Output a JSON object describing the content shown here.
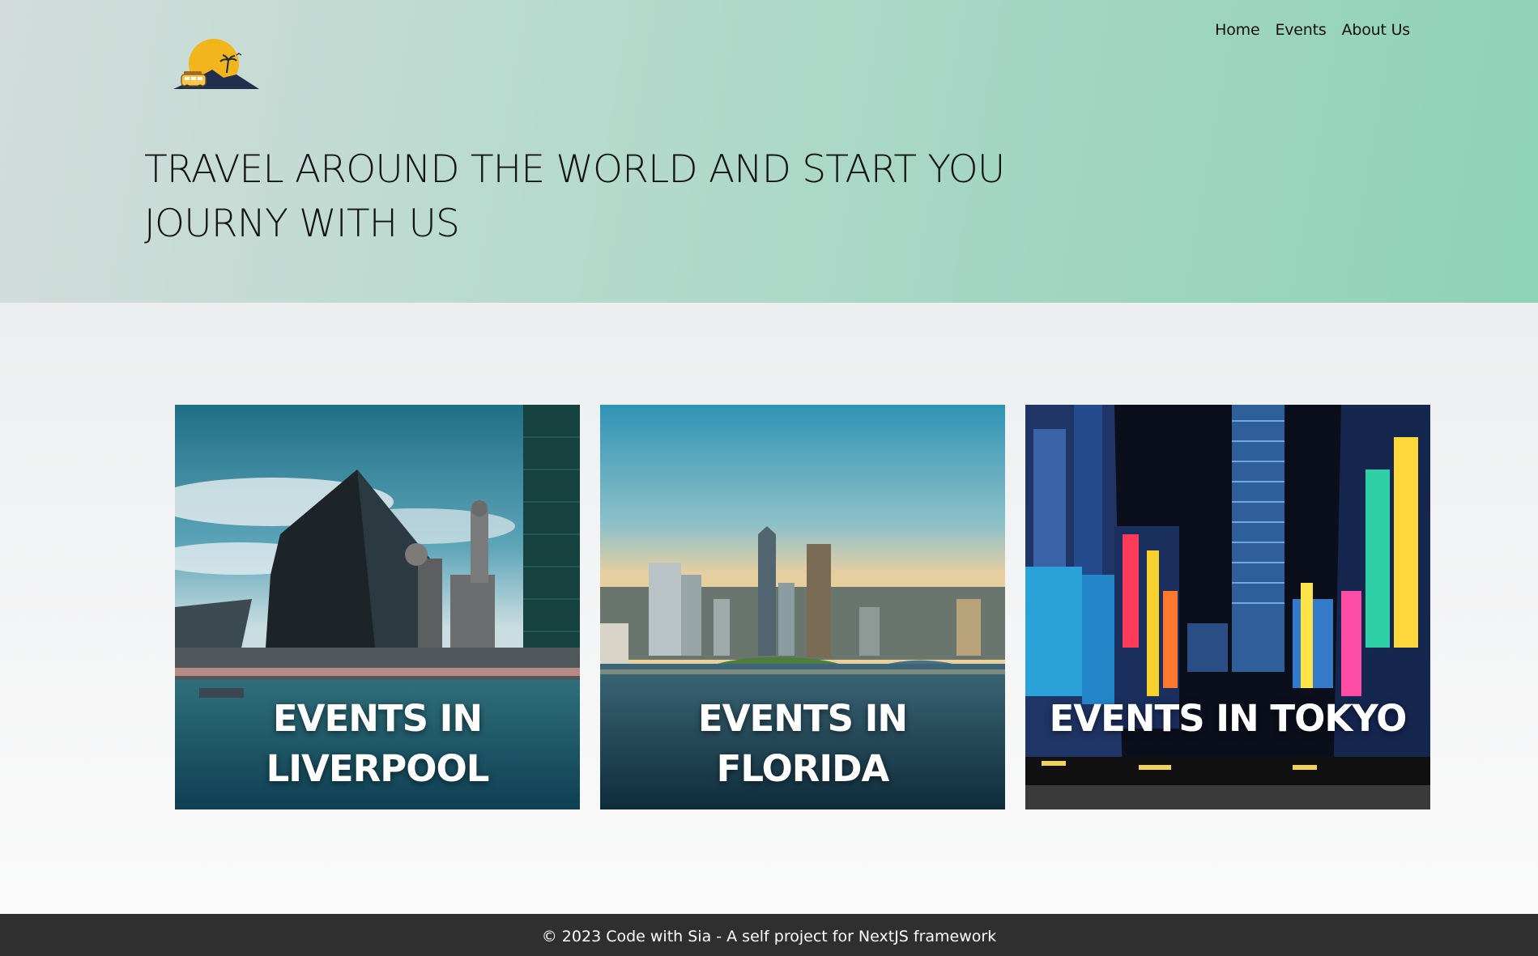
{
  "header": {
    "logo_alt": "travel logo",
    "nav": [
      {
        "label": "Home"
      },
      {
        "label": "Events"
      },
      {
        "label": "About Us"
      }
    ],
    "headline": "TRAVEL AROUND THE WORLD AND START YOU JOURNY WITH US"
  },
  "events": [
    {
      "title": "EVENTS IN LIVERPOOL",
      "image_icon": "liverpool-skyline-photo"
    },
    {
      "title": "EVENTS IN FLORIDA",
      "image_icon": "florida-skyline-photo"
    },
    {
      "title": "EVENTS IN TOKYO",
      "image_icon": "tokyo-street-photo"
    }
  ],
  "footer": {
    "text": "© 2023 Code with Sia - A self project for NextJS framework"
  },
  "colors": {
    "hero_start": "#d3dcdb",
    "hero_end": "#8fd2b8",
    "footer_bg": "#2f2f2f",
    "logo_sun": "#f2b51c",
    "logo_mountain": "#1f2f4d"
  }
}
